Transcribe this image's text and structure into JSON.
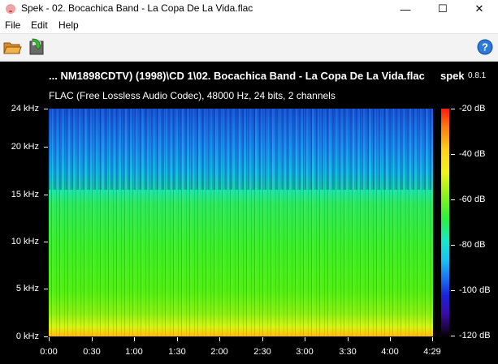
{
  "window": {
    "title": "Spek - 02. Bocachica Band - La Copa De La Vida.flac",
    "minimize": "—",
    "maximize": "☐",
    "close": "✕"
  },
  "menu": [
    "File",
    "Edit",
    "Help"
  ],
  "toolbar": {
    "open_icon": "folder-open-icon",
    "save_icon": "save-icon",
    "help_icon": "help-icon"
  },
  "header": {
    "file_path": "... NM1898CDTV) (1998)\\CD 1\\02. Bocachica Band - La Copa De La Vida.flac",
    "app_name": "spek",
    "app_version": "0.8.1",
    "file_info": "FLAC (Free Lossless Audio Codec), 48000 Hz, 24 bits, 2 channels"
  },
  "frequency_axis": [
    "24 kHz",
    "20 kHz",
    "15 kHz",
    "10 kHz",
    "5 kHz",
    "0 kHz"
  ],
  "time_axis": [
    "0:00",
    "0:30",
    "1:00",
    "1:30",
    "2:00",
    "2:30",
    "3:00",
    "3:30",
    "4:00",
    "4:29"
  ],
  "db_scale": [
    "-20 dB",
    "-40 dB",
    "-60 dB",
    "-80 dB",
    "-100 dB",
    "-120 dB"
  ],
  "colors": {
    "background": "#000000",
    "text": "#ffffff"
  }
}
